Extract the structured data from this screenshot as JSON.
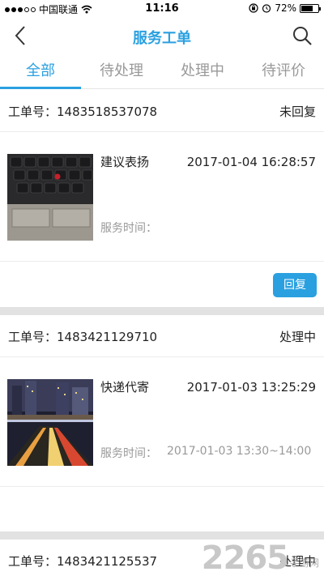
{
  "status_bar": {
    "carrier": "中国联通",
    "time": "11:16",
    "battery": "72%",
    "battery_level": 0.72
  },
  "header": {
    "title": "服务工单"
  },
  "tabs": [
    {
      "label": "全部",
      "active": true
    },
    {
      "label": "待处理",
      "active": false
    },
    {
      "label": "处理中",
      "active": false
    },
    {
      "label": "待评价",
      "active": false
    }
  ],
  "labels": {
    "order_no_prefix": "工单号：",
    "service_time": "服务时间：",
    "reply": "回复"
  },
  "orders": [
    {
      "order_no": "1483518537078",
      "status": "未回复",
      "service": "建议表扬",
      "date": "2017-01-04 16:28:57",
      "service_time": "",
      "has_reply": true
    },
    {
      "order_no": "1483421129710",
      "status": "处理中",
      "service": "快递代寄",
      "date": "2017-01-03 13:25:29",
      "service_time": "2017-01-03 13:30~14:00",
      "has_reply": false
    },
    {
      "order_no": "1483421125537",
      "status": "处理中"
    }
  ],
  "watermark": {
    "number": "2265",
    "text": "手游网"
  }
}
